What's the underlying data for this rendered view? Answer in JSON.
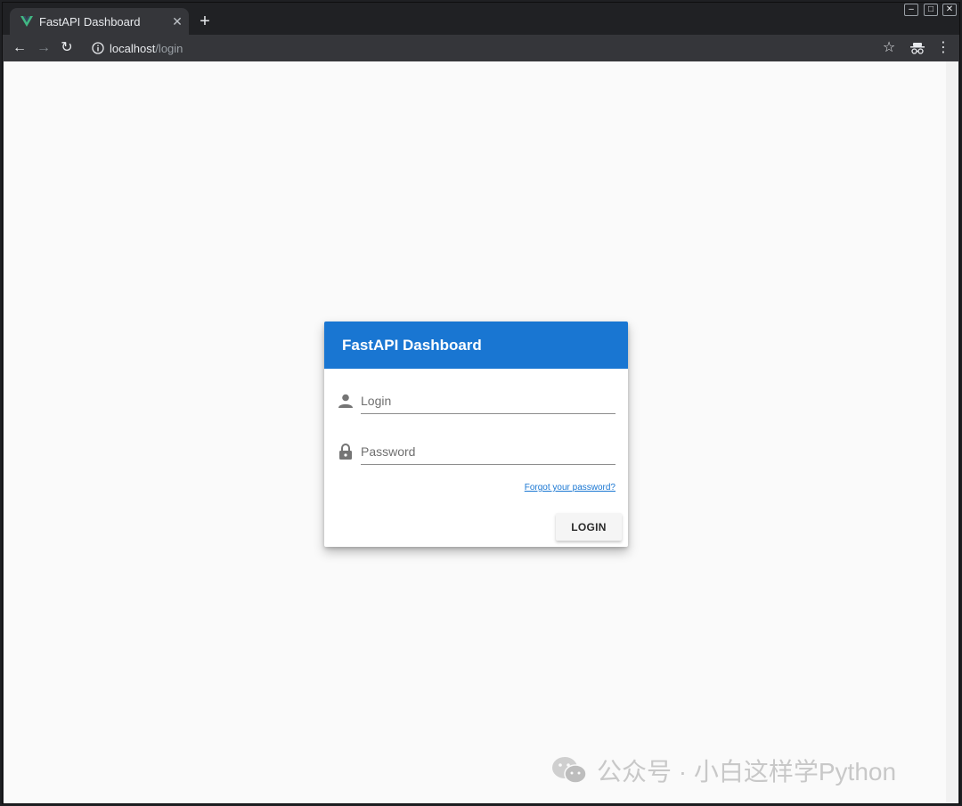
{
  "browser": {
    "tab": {
      "title": "FastAPI Dashboard",
      "favicon": "vue-logo-icon",
      "close_glyph": "✕"
    },
    "newtab_glyph": "+",
    "window_controls": {
      "minimize": "–",
      "maximize": "□",
      "close": "✕"
    },
    "nav": {
      "back": "←",
      "forward": "→",
      "reload": "↻"
    },
    "url": {
      "host": "localhost",
      "path": "/login"
    },
    "toolbar_icons": {
      "bookmark": "☆",
      "incognito": "incognito-icon",
      "menu": "⋮"
    }
  },
  "login_card": {
    "title": "FastAPI Dashboard",
    "header_color": "#1976d2",
    "login_field": {
      "placeholder": "Login",
      "value": "",
      "icon": "person-icon"
    },
    "password_field": {
      "placeholder": "Password",
      "value": "",
      "icon": "lock-icon"
    },
    "forgot_link": "Forgot your password?",
    "submit_label": "LOGIN"
  },
  "watermark": {
    "text": "公众号 · 小白这样学Python",
    "icon": "wechat-logo-icon"
  }
}
